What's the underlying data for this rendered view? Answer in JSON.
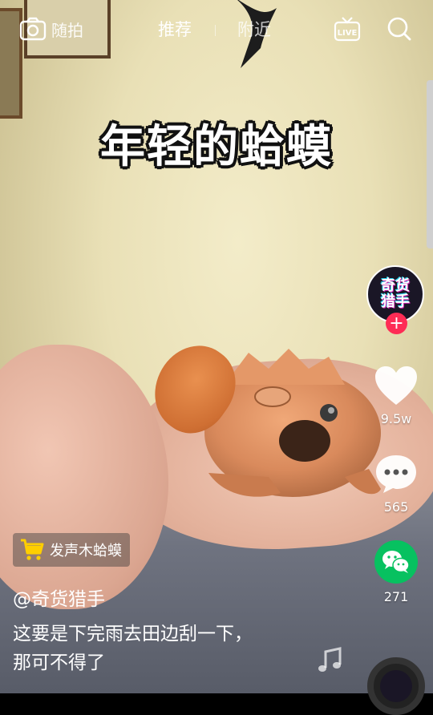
{
  "topbar": {
    "camera_label": "随拍",
    "tab_recommend": "推荐",
    "tab_nearby": "附近",
    "live_label": "LIVE"
  },
  "video": {
    "headline": "年轻的蛤蟆"
  },
  "creator": {
    "avatar_line1": "奇货",
    "avatar_line2": "猎手",
    "follow_symbol": "+"
  },
  "actions": {
    "likes": "9.5w",
    "comments": "565",
    "shares": "271"
  },
  "product": {
    "label": "发声木蛤蟆"
  },
  "post": {
    "author": "@奇货猎手",
    "caption_line1": "这要是下完雨去田边刮一下，",
    "caption_line2": "那可不得了"
  },
  "colors": {
    "follow_red": "#fe2c55",
    "share_green": "#07c160",
    "cart_yellow": "#ffce00"
  },
  "icons": [
    "camera-icon",
    "live-icon",
    "search-icon",
    "heart-icon",
    "comment-icon",
    "wechat-icon",
    "cart-icon",
    "music-note-icon"
  ]
}
